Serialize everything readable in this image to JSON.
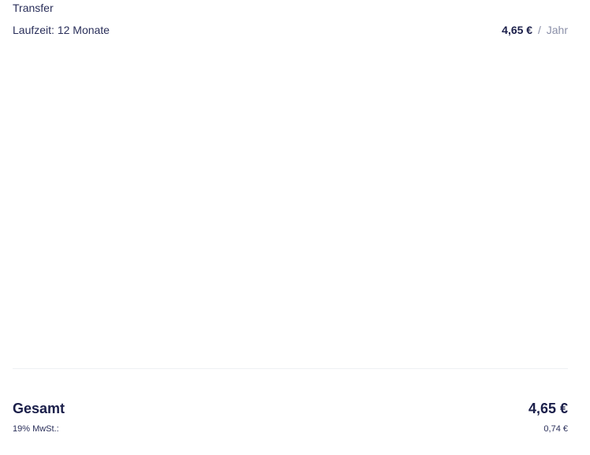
{
  "item": {
    "name": "Transfer",
    "term_label": "Laufzeit: 12 Monate",
    "price": "4,65 €",
    "price_separator": "/",
    "price_period": "Jahr"
  },
  "summary": {
    "total_label": "Gesamt",
    "total_amount": "4,65 €",
    "vat_label": "19% MwSt.:",
    "vat_amount": "0,74 €"
  },
  "colors": {
    "text_primary": "#1b1f4a",
    "text_muted": "#8a8fa8",
    "divider": "#eef0f3"
  }
}
